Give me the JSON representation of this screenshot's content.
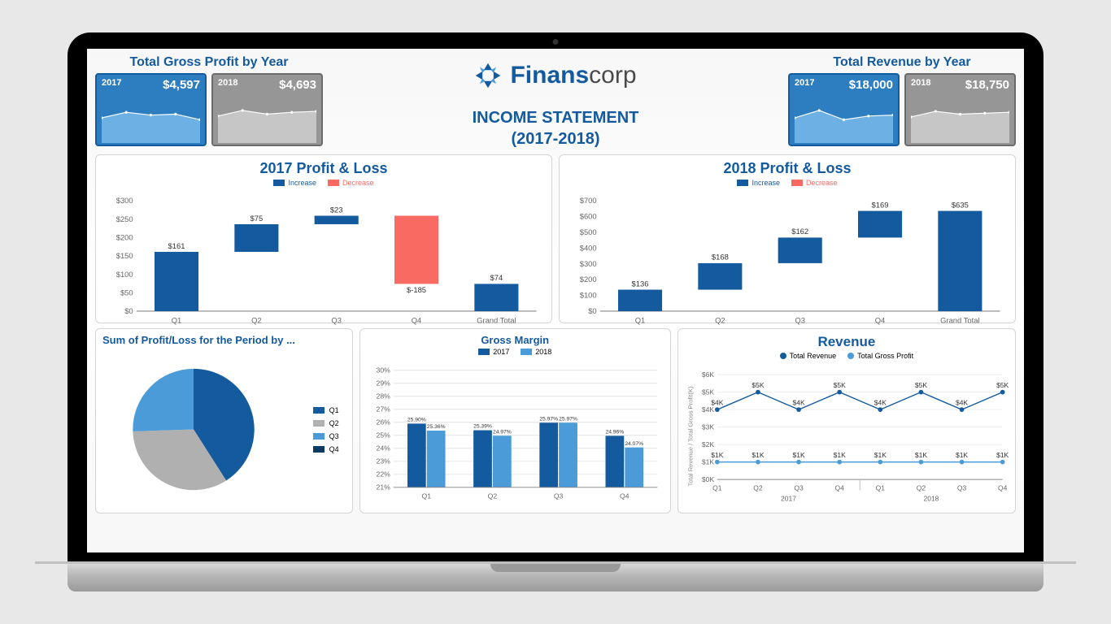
{
  "brand": {
    "name_bold": "Finans",
    "name_rest": "corp"
  },
  "page": {
    "title": "INCOME STATEMENT",
    "subtitle": "(2017-2018)"
  },
  "kpi_left": {
    "title": "Total Gross Profit by Year",
    "cards": [
      {
        "year": "2017",
        "value": "$4,597",
        "variant": "blue"
      },
      {
        "year": "2018",
        "value": "$4,693",
        "variant": "gray"
      }
    ]
  },
  "kpi_right": {
    "title": "Total Revenue by Year",
    "cards": [
      {
        "year": "2017",
        "value": "$18,000",
        "variant": "blue"
      },
      {
        "year": "2018",
        "value": "$18,750",
        "variant": "gray"
      }
    ]
  },
  "pl_2017": {
    "title": "2017 Profit & Loss",
    "legend": [
      {
        "label": "Increase",
        "color": "#145a9e"
      },
      {
        "label": "Decrease",
        "color": "#f96a63"
      }
    ]
  },
  "pl_2018": {
    "title": "2018 Profit & Loss",
    "legend": [
      {
        "label": "Increase",
        "color": "#145a9e"
      },
      {
        "label": "Decrease",
        "color": "#f96a63"
      }
    ]
  },
  "pie": {
    "title": "Sum of Profit/Loss for the Period by ..."
  },
  "gm": {
    "title": "Gross Margin",
    "legend": [
      {
        "label": "2017",
        "color": "#145a9e"
      },
      {
        "label": "2018",
        "color": "#4a9bd8"
      }
    ]
  },
  "rev": {
    "title": "Revenue",
    "legend": [
      {
        "label": "Total Revenue",
        "color": "#145a9e"
      },
      {
        "label": "Total Gross Profit",
        "color": "#4a9bd8"
      }
    ],
    "y_title": "Total Revenue / Total Gross Profit(K)"
  },
  "chart_data": [
    {
      "id": "kpi_spark_gross_2017",
      "type": "area",
      "x": [
        "Q1",
        "Q2",
        "Q3",
        "Q4"
      ],
      "values": [
        1120,
        1180,
        1180,
        1120
      ],
      "color": "#6db1e4"
    },
    {
      "id": "kpi_spark_gross_2018",
      "type": "area",
      "x": [
        "Q1",
        "Q2",
        "Q3",
        "Q4"
      ],
      "values": [
        1150,
        1200,
        1150,
        1190
      ],
      "color": "#c6c6c6"
    },
    {
      "id": "kpi_spark_rev_2017",
      "type": "area",
      "x": [
        "Q1",
        "Q2",
        "Q3",
        "Q4"
      ],
      "values": [
        4400,
        4700,
        4400,
        4500
      ],
      "color": "#6db1e4"
    },
    {
      "id": "kpi_spark_rev_2018",
      "type": "area",
      "x": [
        "Q1",
        "Q2",
        "Q3",
        "Q4"
      ],
      "values": [
        4500,
        4800,
        4700,
        4750
      ],
      "color": "#c6c6c6"
    },
    {
      "id": "pl_2017",
      "type": "waterfall",
      "title": "2017 Profit & Loss",
      "categories": [
        "Q1",
        "Q2",
        "Q3",
        "Q4",
        "Grand Total"
      ],
      "values": [
        161,
        75,
        23,
        -185,
        74
      ],
      "labels": [
        "$161",
        "$75",
        "$23",
        "$-185",
        "$74"
      ],
      "ylim": [
        0,
        300
      ],
      "yticks": [
        0,
        50,
        100,
        150,
        200,
        250,
        300
      ],
      "colors": {
        "increase": "#145a9e",
        "decrease": "#f96a63",
        "total": "#145a9e"
      }
    },
    {
      "id": "pl_2018",
      "type": "waterfall",
      "title": "2018 Profit & Loss",
      "categories": [
        "Q1",
        "Q2",
        "Q3",
        "Q4",
        "Grand Total"
      ],
      "values": [
        136,
        168,
        162,
        169,
        635
      ],
      "labels": [
        "$136",
        "$168",
        "$162",
        "$169",
        "$635"
      ],
      "ylim": [
        0,
        700
      ],
      "yticks": [
        0,
        100,
        200,
        300,
        400,
        500,
        600,
        700
      ],
      "colors": {
        "increase": "#145a9e",
        "decrease": "#f96a63",
        "total": "#145a9e"
      }
    },
    {
      "id": "pie_profit",
      "type": "pie",
      "title": "Sum of Profit/Loss for the Period by ...",
      "categories": [
        "Q1",
        "Q2",
        "Q3",
        "Q4"
      ],
      "values": [
        297,
        243,
        185,
        -16
      ],
      "colors": [
        "#145a9e",
        "#b0b0b0",
        "#4a9bd8",
        "#083a63"
      ]
    },
    {
      "id": "gross_margin",
      "type": "bar",
      "title": "Gross Margin",
      "categories": [
        "Q1",
        "Q2",
        "Q3",
        "Q4"
      ],
      "series": [
        {
          "name": "2017",
          "values": [
            25.9,
            25.39,
            25.97,
            24.96
          ],
          "labels": [
            "25.90%",
            "25.39%",
            "25.97%",
            "24.96%"
          ],
          "color": "#145a9e"
        },
        {
          "name": "2018",
          "values": [
            25.36,
            24.97,
            25.97,
            24.07
          ],
          "labels": [
            "25.36%",
            "24.97%",
            "25.97%",
            "24.07%"
          ],
          "color": "#4a9bd8"
        }
      ],
      "ylim": [
        21,
        30
      ],
      "yticks": [
        21,
        22,
        23,
        24,
        25,
        26,
        27,
        28,
        29,
        30
      ],
      "ylabel": "%"
    },
    {
      "id": "revenue_line",
      "type": "line",
      "title": "Revenue",
      "x_groups": [
        "2017",
        "2018"
      ],
      "x": [
        "Q1",
        "Q2",
        "Q3",
        "Q4",
        "Q1",
        "Q2",
        "Q3",
        "Q4"
      ],
      "series": [
        {
          "name": "Total Revenue",
          "values": [
            4,
            5,
            4,
            5,
            4,
            5,
            4,
            5
          ],
          "labels": [
            "$4K",
            "$5K",
            "$4K",
            "$5K",
            "$4K",
            "$5K",
            "$4K",
            "$5K"
          ],
          "color": "#145a9e"
        },
        {
          "name": "Total Gross Profit",
          "values": [
            1,
            1,
            1,
            1,
            1,
            1,
            1,
            1
          ],
          "labels": [
            "$1K",
            "$1K",
            "$1K",
            "$1K",
            "$1K",
            "$1K",
            "$1K",
            "$1K"
          ],
          "color": "#4a9bd8"
        }
      ],
      "ylim": [
        0,
        6
      ],
      "yticks": [
        0,
        1,
        2,
        3,
        4,
        5,
        6
      ],
      "ylabel": "Total Revenue / Total Gross Profit(K)"
    }
  ]
}
